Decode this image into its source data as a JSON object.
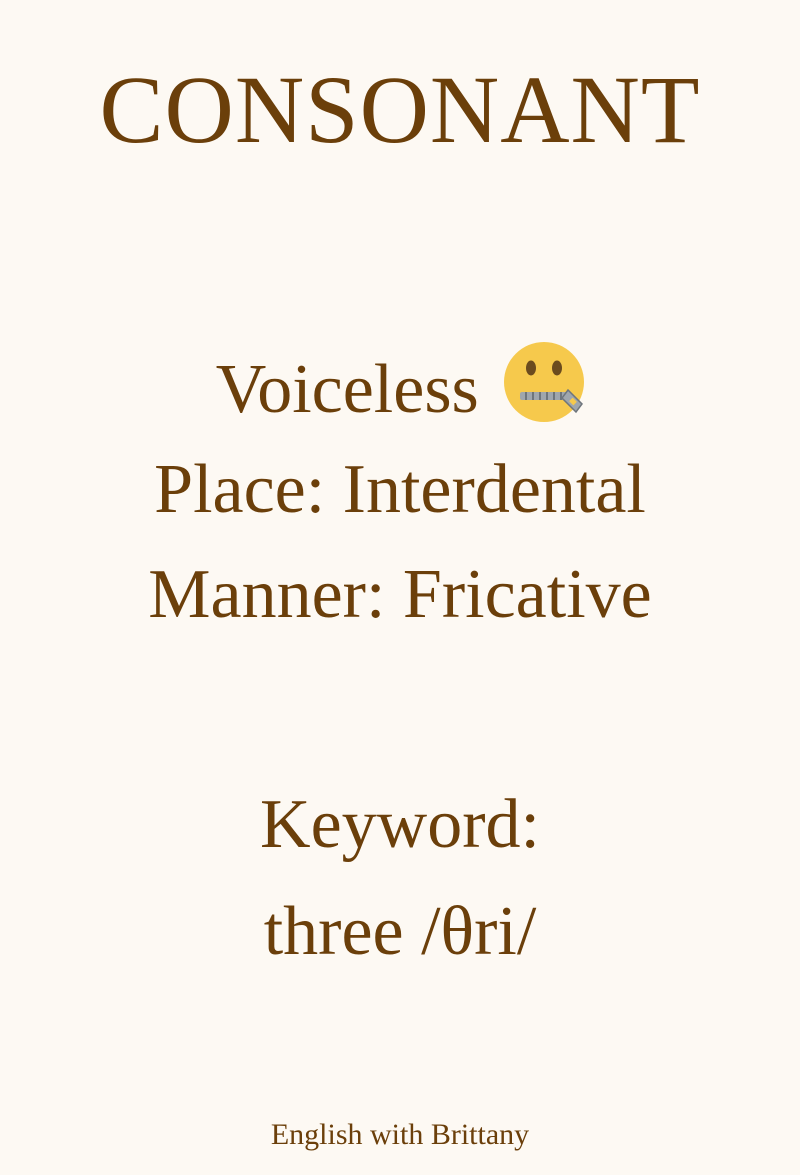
{
  "title": "CONSONANT",
  "voicing": {
    "label": "Voiceless",
    "icon": "zipper-mouth-face-icon"
  },
  "place": "Place: Interdental",
  "manner": "Manner: Fricative",
  "keyword": {
    "label": "Keyword:",
    "value": "three /θri/"
  },
  "footer": "English with Brittany",
  "colors": {
    "background": "#fdf9f3",
    "text": "#6b3f0a",
    "emoji_face": "#f6c94c",
    "emoji_zipper": "#9fa6ad"
  }
}
